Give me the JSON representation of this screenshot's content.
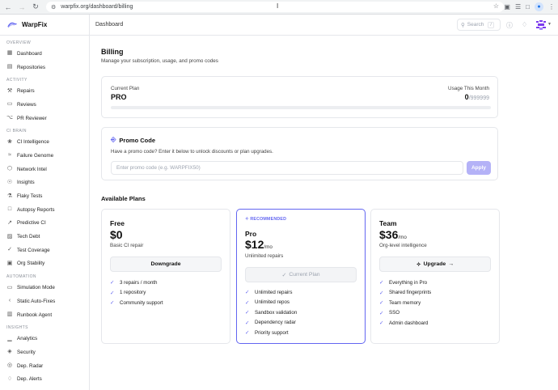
{
  "browser": {
    "url": "warpfix.org/dashboard/billing"
  },
  "brand": {
    "name": "WarpFix",
    "accent": "#6366f1"
  },
  "sidebar": {
    "sections": [
      {
        "label": "OVERVIEW",
        "items": [
          {
            "label": "Dashboard",
            "icon": "grid-icon"
          },
          {
            "label": "Repositories",
            "icon": "folder-icon"
          }
        ]
      },
      {
        "label": "ACTIVITY",
        "items": [
          {
            "label": "Repairs",
            "icon": "wrench-icon"
          },
          {
            "label": "Reviews",
            "icon": "message-icon"
          },
          {
            "label": "PR Reviewer",
            "icon": "pull-request-icon"
          }
        ]
      },
      {
        "label": "CI BRAIN",
        "items": [
          {
            "label": "CI Intelligence",
            "icon": "brain-icon"
          },
          {
            "label": "Failure Genome",
            "icon": "dna-icon"
          },
          {
            "label": "Network Intel",
            "icon": "network-icon"
          },
          {
            "label": "Insights",
            "icon": "lightbulb-icon"
          },
          {
            "label": "Flaky Tests",
            "icon": "flask-icon"
          },
          {
            "label": "Autopsy Reports",
            "icon": "document-icon"
          },
          {
            "label": "Predictive CI",
            "icon": "trend-icon"
          },
          {
            "label": "Tech Debt",
            "icon": "layers-icon"
          },
          {
            "label": "Test Coverage",
            "icon": "shield-check-icon"
          },
          {
            "label": "Org Stability",
            "icon": "building-icon"
          }
        ]
      },
      {
        "label": "AUTOMATION",
        "items": [
          {
            "label": "Simulation Mode",
            "icon": "monitor-icon"
          },
          {
            "label": "Static Auto-Fixes",
            "icon": "code-icon"
          },
          {
            "label": "Runbook Agent",
            "icon": "book-icon"
          }
        ]
      },
      {
        "label": "INSIGHTS",
        "items": [
          {
            "label": "Analytics",
            "icon": "chart-icon"
          },
          {
            "label": "Security",
            "icon": "shield-icon"
          },
          {
            "label": "Dep. Radar",
            "icon": "radar-icon"
          },
          {
            "label": "Dep. Alerts",
            "icon": "bell-icon"
          }
        ]
      }
    ]
  },
  "topbar": {
    "breadcrumb": "Dashboard",
    "search_placeholder": "Search",
    "search_shortcut": "/"
  },
  "page": {
    "title": "Billing",
    "subtitle": "Manage your subscription, usage, and promo codes"
  },
  "current_plan": {
    "label": "Current Plan",
    "value": "PRO",
    "usage_label": "Usage This Month",
    "usage_value": "0",
    "usage_max": "/999999",
    "usage_fraction": 0
  },
  "promo": {
    "title": "Promo Code",
    "description": "Have a promo code? Enter it below to unlock discounts or plan upgrades.",
    "input_value": "",
    "input_placeholder": "Enter promo code (e.g. WARPFIX50)",
    "apply_label": "Apply"
  },
  "plans_title": "Available Plans",
  "plans": [
    {
      "name": "Free",
      "price": "$0",
      "per": "",
      "description": "Basic CI repair",
      "button_label": "Downgrade",
      "features": [
        "3 repairs / month",
        "1 repository",
        "Community support"
      ]
    },
    {
      "badge": "RECOMMENDED",
      "name": "Pro",
      "price": "$12",
      "per": "/mo",
      "description": "Unlimited repairs",
      "button_label": "Current Plan",
      "features": [
        "Unlimited repairs",
        "Unlimited repos",
        "Sandbox validation",
        "Dependency radar",
        "Priority support"
      ]
    },
    {
      "name": "Team",
      "price": "$36",
      "per": "/mo",
      "description": "Org-level intelligence",
      "button_label": "Upgrade",
      "features": [
        "Everything in Pro",
        "Shared fingerprints",
        "Team memory",
        "SSO",
        "Admin dashboard"
      ]
    }
  ]
}
